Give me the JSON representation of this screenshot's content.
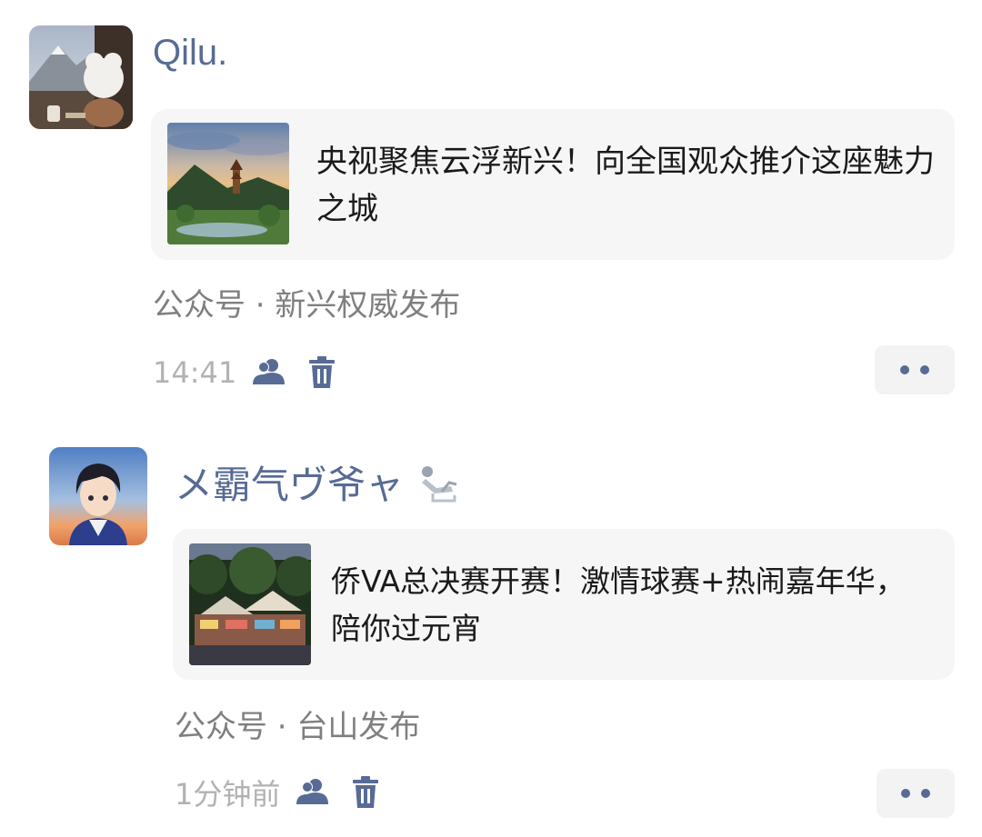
{
  "posts": [
    {
      "nickname": "Qilu.",
      "card": {
        "title": "央视聚焦云浮新兴！向全国观众推介这座魅力之城"
      },
      "source": "公众号 · 新兴权威发布",
      "time": "14:41",
      "icons": [
        "avatar",
        "article-thumbnail-icon",
        "contacts-visibility-icon",
        "trash-icon",
        "more-dots-icon"
      ]
    },
    {
      "nickname": "メ霸气ヴ爷ャ",
      "card": {
        "title": "侨VA总决赛开赛！激情球赛+热闹嘉年华，陪你过元宵"
      },
      "source": "公众号 · 台山发布",
      "time": "1分钟前",
      "icons": [
        "avatar",
        "status-relax-icon",
        "article-thumbnail-icon",
        "contacts-visibility-icon",
        "trash-icon",
        "more-dots-icon"
      ]
    }
  ],
  "colors": {
    "nickname": "#576b95",
    "card_bg": "#f6f6f6",
    "text": "#1a1a1a",
    "source": "#7f7f7f",
    "timestamp": "#b2b2b2"
  }
}
